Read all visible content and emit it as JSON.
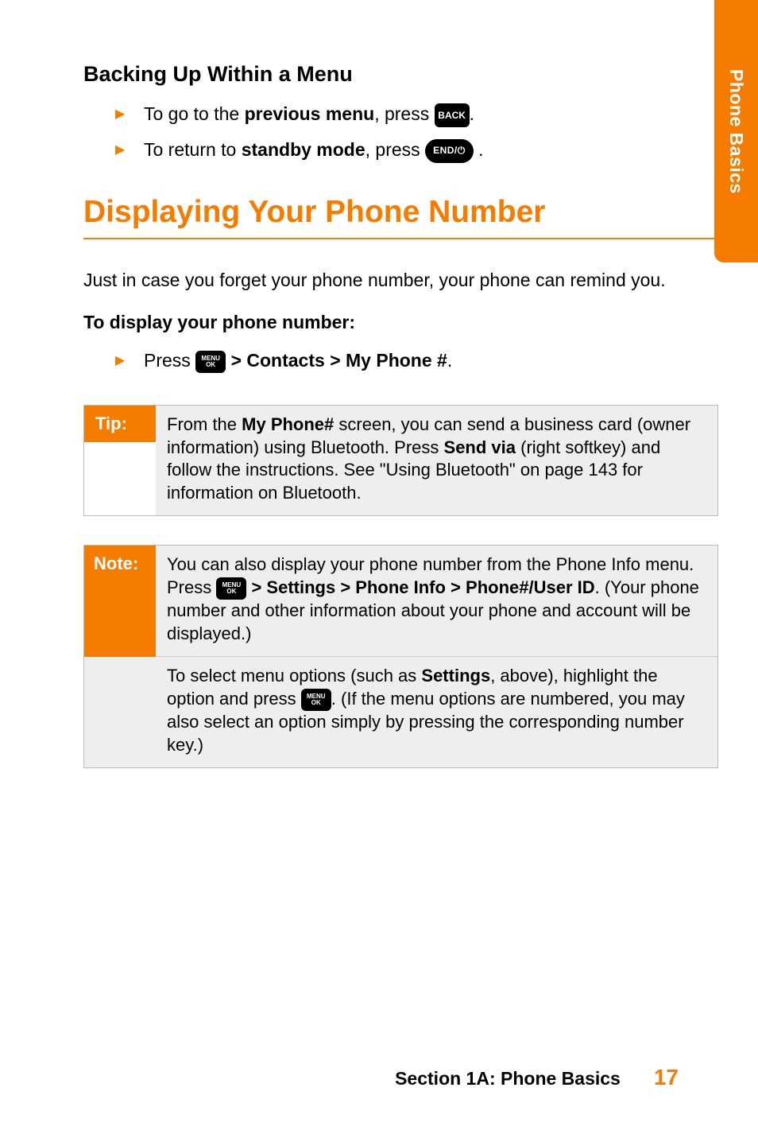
{
  "sideTab": "Phone Basics",
  "h_sub": "Backing Up Within a Menu",
  "bullets": {
    "b1_pre": "To go to the ",
    "b1_bold": "previous menu",
    "b1_post": ", press ",
    "b2_pre": "To return to ",
    "b2_bold": "standby mode",
    "b2_post": ", press "
  },
  "key_back": "BACK",
  "key_end": "END/⏻",
  "key_menu_top": "MENU",
  "key_menu_bot": "OK",
  "h_main": "Displaying Your Phone Number",
  "para1": "Just in case you forget your phone number, your phone can remind you.",
  "step_head": "To display your phone number:",
  "step1_pre": "Press ",
  "step1_bold": " > Contacts > My Phone #",
  "tip_label": "Tip:",
  "tip_1a": "From the ",
  "tip_1b": "My Phone#",
  "tip_1c": " screen, you can send a business card (owner information) using Bluetooth. Press ",
  "tip_1d": "Send via",
  "tip_1e": " (right softkey) and follow the instructions. See \"Using Bluetooth\" on page 143 for information on Bluetooth.",
  "note_label": "Note:",
  "note1_a": "You can also display your phone number from the Phone Info menu. Press ",
  "note1_b": " > Settings > Phone Info > Phone#/User ID",
  "note1_c": ". (Your phone number and other information about your phone and account will be displayed.)",
  "note2_a": "To select menu options (such as ",
  "note2_b": "Settings",
  "note2_c": ", above), highlight the option and press ",
  "note2_d": ". (If the menu options are numbered, you may also select an option simply by pressing the corresponding number key.)",
  "footer_section": "Section 1A: Phone Basics",
  "footer_page": "17"
}
